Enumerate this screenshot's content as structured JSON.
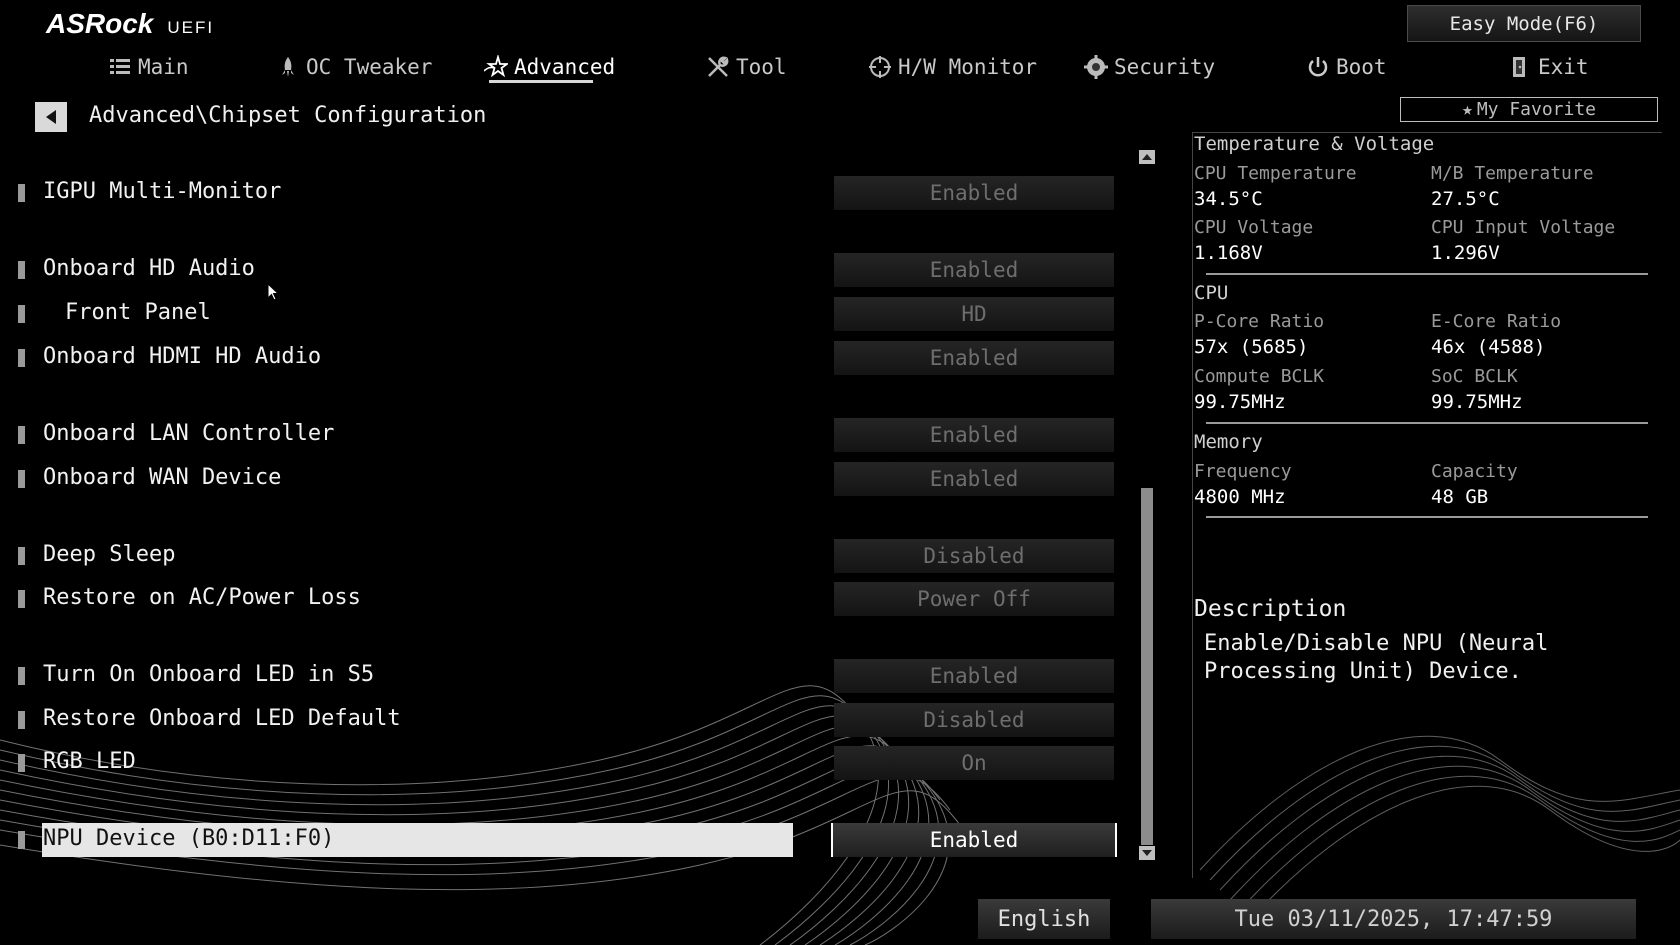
{
  "header": {
    "brand": "ASRock",
    "brand_sub": "UEFI",
    "easy_mode_label": "Easy Mode(F6)",
    "tabs": [
      {
        "label": "Main",
        "icon": "list-icon"
      },
      {
        "label": "OC Tweaker",
        "icon": "rocket-icon"
      },
      {
        "label": "Advanced",
        "icon": "star-swoosh-icon",
        "active": true
      },
      {
        "label": "Tool",
        "icon": "wrench-screwdriver-icon"
      },
      {
        "label": "H/W Monitor",
        "icon": "crosshair-icon"
      },
      {
        "label": "Security",
        "icon": "shield-gear-icon"
      },
      {
        "label": "Boot",
        "icon": "power-icon"
      },
      {
        "label": "Exit",
        "icon": "door-exit-icon"
      }
    ]
  },
  "breadcrumb": "Advanced\\Chipset Configuration",
  "favorite_label": "My Favorite",
  "settings": [
    {
      "label": "IGPU Multi-Monitor",
      "value": "Enabled"
    },
    {
      "label": "Onboard HD Audio",
      "value": "Enabled"
    },
    {
      "label": "Front Panel",
      "value": "HD"
    },
    {
      "label": "Onboard HDMI HD Audio",
      "value": "Enabled"
    },
    {
      "label": "Onboard LAN Controller",
      "value": "Enabled"
    },
    {
      "label": "Onboard WAN Device",
      "value": "Enabled"
    },
    {
      "label": "Deep Sleep",
      "value": "Disabled"
    },
    {
      "label": "Restore on AC/Power Loss",
      "value": "Power Off"
    },
    {
      "label": "Turn On Onboard LED in S5",
      "value": "Enabled"
    },
    {
      "label": "Restore Onboard LED Default",
      "value": "Disabled"
    },
    {
      "label": "RGB LED",
      "value": "On"
    },
    {
      "label": "NPU Device (B0:D11:F0)",
      "value": "Enabled",
      "selected": true
    }
  ],
  "monitor": {
    "temp_voltage": {
      "title": "Temperature & Voltage",
      "cpu_temp_label": "CPU Temperature",
      "cpu_temp": "34.5°C",
      "mb_temp_label": "M/B Temperature",
      "mb_temp": "27.5°C",
      "cpu_voltage_label": "CPU Voltage",
      "cpu_voltage": "1.168V",
      "cpu_input_voltage_label": "CPU Input Voltage",
      "cpu_input_voltage": "1.296V"
    },
    "cpu": {
      "title": "CPU",
      "pcore_label": "P-Core Ratio",
      "pcore": "57x (5685)",
      "ecore_label": "E-Core Ratio",
      "ecore": "46x (4588)",
      "compute_bclk_label": "Compute BCLK",
      "compute_bclk": "99.75MHz",
      "soc_bclk_label": "SoC BCLK",
      "soc_bclk": "99.75MHz"
    },
    "memory": {
      "title": "Memory",
      "frequency_label": "Frequency",
      "frequency": "4800 MHz",
      "capacity_label": "Capacity",
      "capacity": "48 GB"
    }
  },
  "description": {
    "title": "Description",
    "text": "Enable/Disable NPU (Neural Processing Unit) Device."
  },
  "footer": {
    "language": "English",
    "datetime": "Tue 03/11/2025, 17:47:59"
  },
  "colors": {
    "background": "#000000",
    "selected_row": "#e6e6e6",
    "inactive_value_text": "#6e6e6e"
  }
}
